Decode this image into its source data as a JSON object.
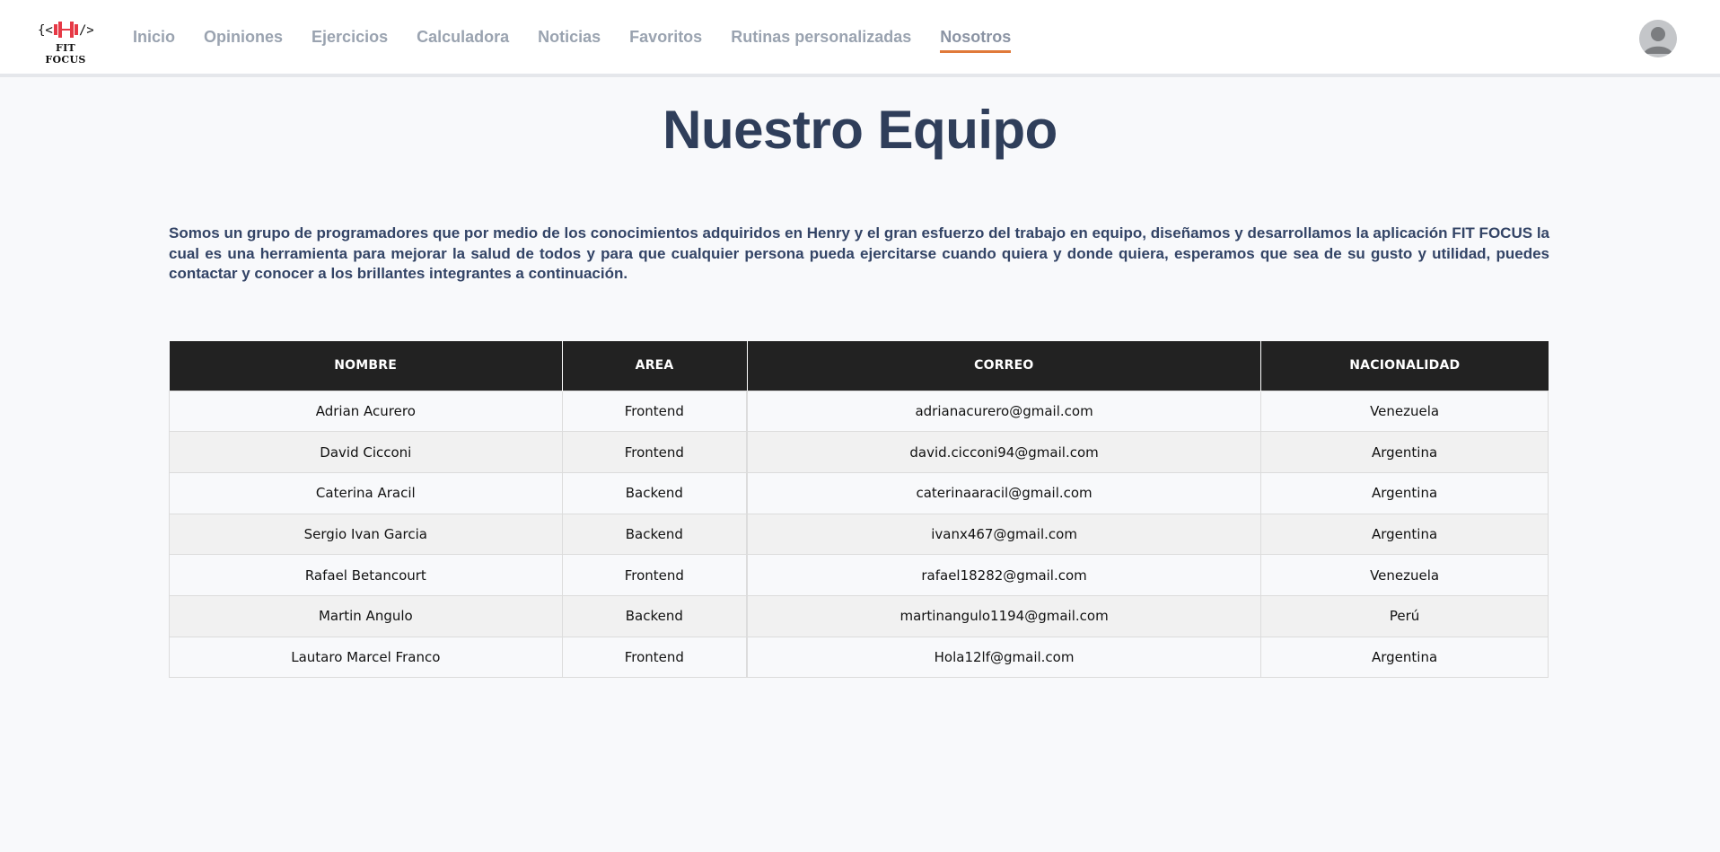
{
  "logo": {
    "mark": "{<|–|>}",
    "text": "FIT FOCUS",
    "accent_color": "#e63946"
  },
  "nav": {
    "items": [
      {
        "label": "Inicio",
        "active": false
      },
      {
        "label": "Opiniones",
        "active": false
      },
      {
        "label": "Ejercicios",
        "active": false
      },
      {
        "label": "Calculadora",
        "active": false
      },
      {
        "label": "Noticias",
        "active": false
      },
      {
        "label": "Favoritos",
        "active": false
      },
      {
        "label": "Rutinas personalizadas",
        "active": false
      },
      {
        "label": "Nosotros",
        "active": true
      }
    ],
    "active_underline_color": "#e07a3a"
  },
  "avatar_icon": "user-avatar-icon",
  "main": {
    "title": "Nuestro Equipo",
    "intro": "Somos un grupo de programadores que por medio de los conocimientos adquiridos en Henry y el gran esfuerzo del trabajo en equipo, diseñamos y desarrollamos la aplicación FIT FOCUS la cual es una herramienta para mejorar la salud de todos y para que cualquier persona pueda ejercitarse cuando quiera y donde quiera, esperamos que sea de su gusto y utilidad, puedes contactar y conocer a los brillantes integrantes a continuación."
  },
  "table": {
    "headers": [
      "NOMBRE",
      "AREA",
      "CORREO",
      "NACIONALIDAD"
    ],
    "rows": [
      [
        "Adrian Acurero",
        "Frontend",
        "adrianacurero@gmail.com",
        "Venezuela"
      ],
      [
        "David Cicconi",
        "Frontend",
        "david.cicconi94@gmail.com",
        "Argentina"
      ],
      [
        "Caterina Aracil",
        "Backend",
        "caterinaaracil@gmail.com",
        "Argentina"
      ],
      [
        "Sergio Ivan Garcia",
        "Backend",
        "ivanx467@gmail.com",
        "Argentina"
      ],
      [
        "Rafael Betancourt",
        "Frontend",
        "rafael18282@gmail.com",
        "Venezuela"
      ],
      [
        "Martin Angulo",
        "Backend",
        "martinangulo1194@gmail.com",
        "Perú"
      ],
      [
        "Lautaro Marcel Franco",
        "Frontend",
        "Hola12lf@gmail.com",
        "Argentina"
      ]
    ]
  }
}
